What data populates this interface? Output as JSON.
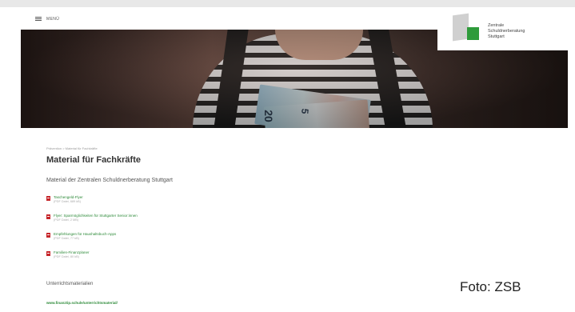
{
  "header": {
    "menu_label": "MENÜ",
    "logo_lines": [
      "Zentrale",
      "Schuldnerberatung",
      "Stuttgart"
    ]
  },
  "hero": {
    "banknote_numbers": [
      "20",
      "5"
    ]
  },
  "breadcrumb": "Prävention > Material für Fachkräfte",
  "page_title": "Material für Fachkräfte",
  "subtitle": "Material der Zentralen Schuldnerberatung Stuttgart",
  "documents": [
    {
      "title": "Taschengeld-Flyer",
      "meta": "(PDF Datei, 689 kB)"
    },
    {
      "title": "Flyer: Sparmöglichkeiten für Stuttgarter Senior:innen",
      "meta": "(PDF Datei, 2 MB)"
    },
    {
      "title": "Empfehlungen für Haushaltsbuch-Apps",
      "meta": "(PDF Datei, 77 kB)"
    },
    {
      "title": "Familien-Finanzplaner",
      "meta": "(PDF Datei, 80 kB)"
    }
  ],
  "section_heading": "Unterrichtsmaterialien",
  "external_link": "www.finanztip.schule/unterrichtsmaterial/",
  "photo_credit": "Foto: ZSB",
  "colors": {
    "accent_green": "#2e8b3a",
    "pdf_red": "#c6262b",
    "logo_green": "#2e9b3a"
  },
  "icons": {
    "menu": "hamburger-icon",
    "document": "pdf-file-icon"
  }
}
